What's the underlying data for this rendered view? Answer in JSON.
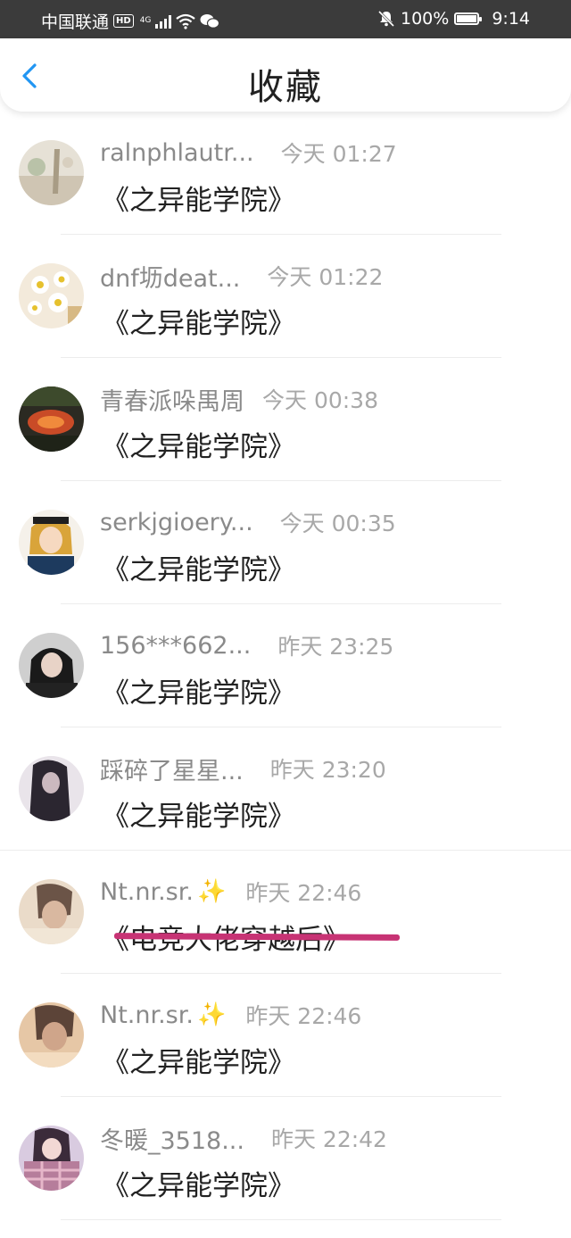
{
  "status_bar": {
    "carrier": "中国联通",
    "hd": "HD",
    "network": "4G",
    "battery": "100%",
    "time": "9:14"
  },
  "header": {
    "title": "收藏",
    "back_icon": "chevron-left-icon"
  },
  "colors": {
    "accent": "#2196F3",
    "name_gray": "#8a8a8a",
    "time_gray": "#a8a8a8",
    "strike": "#c73374"
  },
  "items": [
    {
      "name": "ralnphlautr...",
      "time": "今天 01:27",
      "title": "《之异能学院》"
    },
    {
      "name": "dnf坜deat...",
      "time": "今天 01:22",
      "title": "《之异能学院》"
    },
    {
      "name": "青春派哚禺周",
      "time": "今天 00:38",
      "title": "《之异能学院》"
    },
    {
      "name": "serkjgioery...",
      "time": "今天 00:35",
      "title": "《之异能学院》"
    },
    {
      "name": "156***662...",
      "time": "昨天 23:25",
      "title": "《之异能学院》"
    },
    {
      "name": "踩碎了星星...",
      "time": "昨天 23:20",
      "title": "《之异能学院》"
    },
    {
      "name": "Nt.nr.sr.",
      "time": "昨天 22:46",
      "title": "《电竞大佬穿越后》",
      "sparkle": "✨"
    },
    {
      "name": "Nt.nr.sr.",
      "time": "昨天 22:46",
      "title": "《之异能学院》",
      "sparkle": "✨"
    },
    {
      "name": "冬暖_3518...",
      "time": "昨天 22:42",
      "title": "《之异能学院》"
    }
  ]
}
